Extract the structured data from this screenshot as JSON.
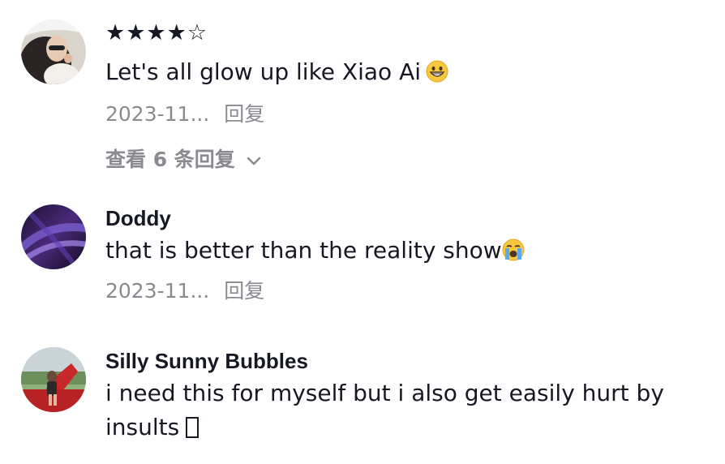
{
  "comments": [
    {
      "username": "",
      "rating_text": "★★★★☆",
      "rating": 4,
      "rating_max": 5,
      "text": "Let's all glow up like Xiao Ai",
      "emoji": "grinning-face-icon",
      "date": "2023-11...",
      "reply_label": "回复",
      "view_replies_label": "查看 6 条回复"
    },
    {
      "username": "Doddy",
      "text": "that is better than the reality show",
      "emoji": "loudly-crying-face-icon",
      "date": "2023-11...",
      "reply_label": "回复"
    },
    {
      "username": "Silly Sunny Bubbles",
      "text": "i need this for myself but i also get easily hurt by insults",
      "emoji": "unrendered-glyph-icon"
    }
  ],
  "colors": {
    "primary_text": "#161823",
    "secondary_text": "#8a8b91",
    "background": "#ffffff"
  }
}
